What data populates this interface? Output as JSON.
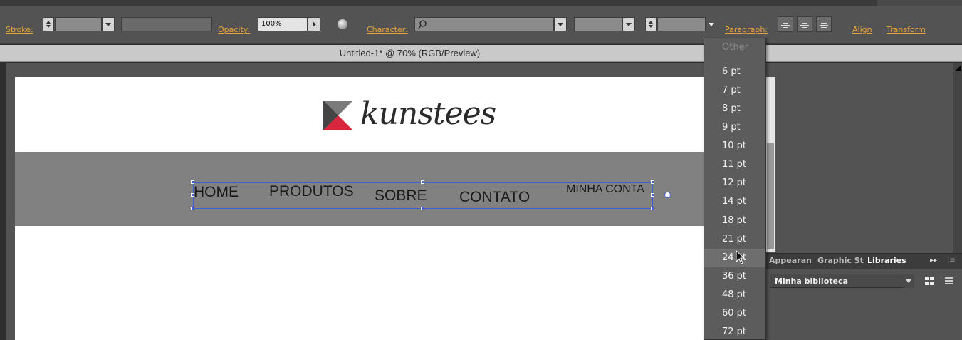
{
  "control_bar": {
    "stroke_label": "Stroke:",
    "opacity_label": "Opacity:",
    "opacity_value": "100%",
    "character_label": "Character:",
    "character_search": "",
    "paragraph_label": "Paragraph:",
    "align_label": "Align",
    "transform_label": "Transform"
  },
  "document": {
    "title": "Untitled-1* @ 70% (RGB/Preview)"
  },
  "artboard": {
    "logo_text": "kunstees",
    "nav_items": [
      "HOME",
      "PRODUTOS",
      "SOBRE",
      "CONTATO",
      "MINHA CONTA"
    ]
  },
  "font_size_menu": {
    "items": [
      "Other",
      "6 pt",
      "7 pt",
      "8 pt",
      "9 pt",
      "10 pt",
      "11 pt",
      "12 pt",
      "14 pt",
      "18 pt",
      "21 pt",
      "24 pt",
      "36 pt",
      "48 pt",
      "60 pt",
      "72 pt"
    ],
    "highlighted": "24 pt"
  },
  "panel": {
    "tabs": [
      "Appearance",
      "Graphic Styles",
      "Libraries"
    ],
    "tab_visible": [
      "Appearan",
      "Graphic St",
      "Libraries"
    ],
    "active_tab": "Libraries",
    "library_name": "Minha biblioteca"
  },
  "colors": {
    "accent_link": "#e8a43a",
    "selection": "#3f5fd6",
    "logo_red": "#d7263d",
    "logo_dark": "#2a2a2a",
    "nav_band": "#818181"
  },
  "icons": [
    "spinner-icon",
    "dropdown-arrow-icon",
    "arrow-right-icon",
    "globe-icon",
    "search-icon",
    "align-left-icon",
    "align-center-icon",
    "align-right-icon",
    "expand-panel-icon",
    "panel-menu-icon",
    "grid-view-icon",
    "list-view-icon",
    "mouse-cursor-icon"
  ]
}
